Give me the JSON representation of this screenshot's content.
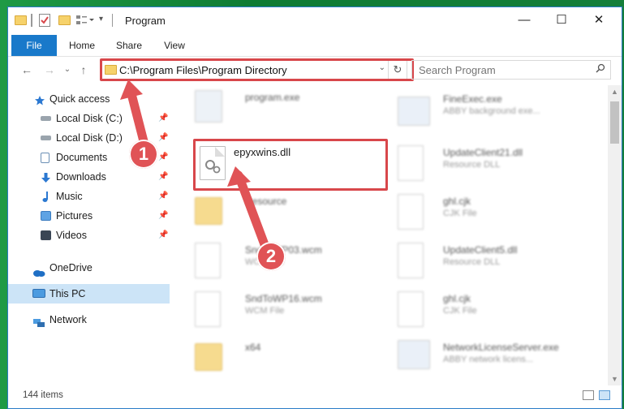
{
  "window": {
    "title": "Program",
    "controls": {
      "minimize": "—",
      "maximize": "☐",
      "close": "✕"
    }
  },
  "ribbon": {
    "tabs": [
      "File",
      "Home",
      "Share",
      "View"
    ]
  },
  "address": {
    "path": "C:\\Program Files\\Program Directory",
    "dropdown_glyph": "⌄",
    "refresh_glyph": "↻"
  },
  "search": {
    "placeholder": "Search Program",
    "icon": "search-icon"
  },
  "nav": {
    "back": "←",
    "forward": "→",
    "recent": "⌄",
    "up": "↑"
  },
  "sidebar": {
    "quick_access": "Quick access",
    "pinned": [
      {
        "label": "Local Disk (C:)",
        "icon": "drive-icon"
      },
      {
        "label": "Local Disk (D:)",
        "icon": "drive-icon"
      },
      {
        "label": "Documents",
        "icon": "documents-icon"
      },
      {
        "label": "Downloads",
        "icon": "downloads-icon"
      },
      {
        "label": "Music",
        "icon": "music-icon"
      },
      {
        "label": "Pictures",
        "icon": "pictures-icon"
      },
      {
        "label": "Videos",
        "icon": "videos-icon"
      }
    ],
    "onedrive": "OneDrive",
    "this_pc": "This PC",
    "network": "Network"
  },
  "files": {
    "left": [
      {
        "name": "program.exe",
        "sub": ""
      },
      {
        "name": "epyxwins.dll",
        "sub": ""
      },
      {
        "name": "Resource",
        "sub": ""
      },
      {
        "name": "SndToWP03.wcm",
        "sub": "WCM File"
      },
      {
        "name": "SndToWP16.wcm",
        "sub": "WCM File"
      },
      {
        "name": "x64",
        "sub": ""
      }
    ],
    "right": [
      {
        "name": "FineExec.exe",
        "sub": "ABBY background exe..."
      },
      {
        "name": "UpdateClient21.dll",
        "sub": "Resource DLL"
      },
      {
        "name": "ghl.cjk",
        "sub": "CJK File"
      },
      {
        "name": "UpdateClient5.dll",
        "sub": "Resource DLL"
      },
      {
        "name": "ghl.cjk",
        "sub": "CJK File"
      },
      {
        "name": "NetworkLicenseServer.exe",
        "sub": "ABBY network licens..."
      }
    ]
  },
  "callouts": [
    "1",
    "2"
  ],
  "status": {
    "items": "144 items"
  },
  "colors": {
    "accent": "#1979ca",
    "highlight": "#d8474b",
    "selected": "#cce4f7"
  }
}
